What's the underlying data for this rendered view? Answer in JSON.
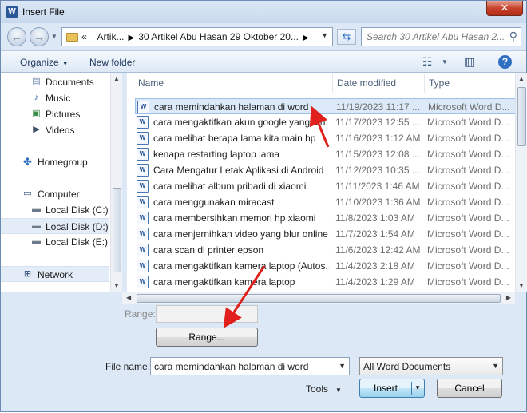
{
  "window": {
    "title": "Insert File",
    "app_icon": "W"
  },
  "address": {
    "prefix": "«",
    "crumbs": [
      "Artik...",
      "30 Artikel Abu Hasan 29 Oktober 20..."
    ]
  },
  "search": {
    "placeholder": "Search 30 Artikel Abu Hasan 2..."
  },
  "toolbar": {
    "organize": "Organize",
    "new_folder": "New folder"
  },
  "sidebar": {
    "items": [
      {
        "label": "Documents",
        "icon": "documents-icon"
      },
      {
        "label": "Music",
        "icon": "music-icon"
      },
      {
        "label": "Pictures",
        "icon": "pictures-icon"
      },
      {
        "label": "Videos",
        "icon": "videos-icon"
      },
      {
        "label": "Homegroup",
        "icon": "homegroup-icon"
      },
      {
        "label": "Computer",
        "icon": "computer-icon"
      },
      {
        "label": "Local Disk (C:)",
        "icon": "drive-icon"
      },
      {
        "label": "Local Disk (D:)",
        "icon": "drive-icon"
      },
      {
        "label": "Local Disk (E:)",
        "icon": "drive-icon"
      },
      {
        "label": "Network",
        "icon": "network-icon"
      }
    ]
  },
  "columns": {
    "name": "Name",
    "date": "Date modified",
    "type": "Type"
  },
  "files": [
    {
      "name": "cara memindahkan halaman di word",
      "date": "11/19/2023 11:17 ...",
      "type": "Microsoft Word D..."
    },
    {
      "name": "cara mengaktifkan akun google yang din...",
      "date": "11/17/2023 12:55 ...",
      "type": "Microsoft Word D..."
    },
    {
      "name": "cara melihat berapa lama kita main hp",
      "date": "11/16/2023 1:12 AM",
      "type": "Microsoft Word D..."
    },
    {
      "name": "kenapa restarting laptop lama",
      "date": "11/15/2023 12:08 ...",
      "type": "Microsoft Word D..."
    },
    {
      "name": "Cara Mengatur Letak Aplikasi di Android",
      "date": "11/12/2023 10:35 ...",
      "type": "Microsoft Word D..."
    },
    {
      "name": "cara melihat album pribadi di xiaomi",
      "date": "11/11/2023 1:46 AM",
      "type": "Microsoft Word D..."
    },
    {
      "name": "cara menggunakan miracast",
      "date": "11/10/2023 1:36 AM",
      "type": "Microsoft Word D..."
    },
    {
      "name": "cara membersihkan memori hp xiaomi",
      "date": "11/8/2023 1:03 AM",
      "type": "Microsoft Word D..."
    },
    {
      "name": "cara menjernihkan video yang blur online",
      "date": "11/7/2023 1:54 AM",
      "type": "Microsoft Word D..."
    },
    {
      "name": "cara scan di printer epson",
      "date": "11/6/2023 12:42 AM",
      "type": "Microsoft Word D..."
    },
    {
      "name": "cara mengaktifkan kamera laptop (Autos...",
      "date": "11/4/2023 2:18 AM",
      "type": "Microsoft Word D..."
    },
    {
      "name": "cara mengaktifkan kamera laptop",
      "date": "11/4/2023 1:29 AM",
      "type": "Microsoft Word D..."
    }
  ],
  "range": {
    "label": "Range:",
    "button": "Range..."
  },
  "file_name": {
    "label": "File name:",
    "value": "cara memindahkan halaman di word"
  },
  "file_type": {
    "value": "All Word Documents"
  },
  "actions": {
    "tools": "Tools",
    "insert": "Insert",
    "cancel": "Cancel"
  },
  "colors": {
    "selection": "#dce9f8",
    "annotation_arrow": "#e0201c",
    "chrome": "#dce8f5"
  }
}
